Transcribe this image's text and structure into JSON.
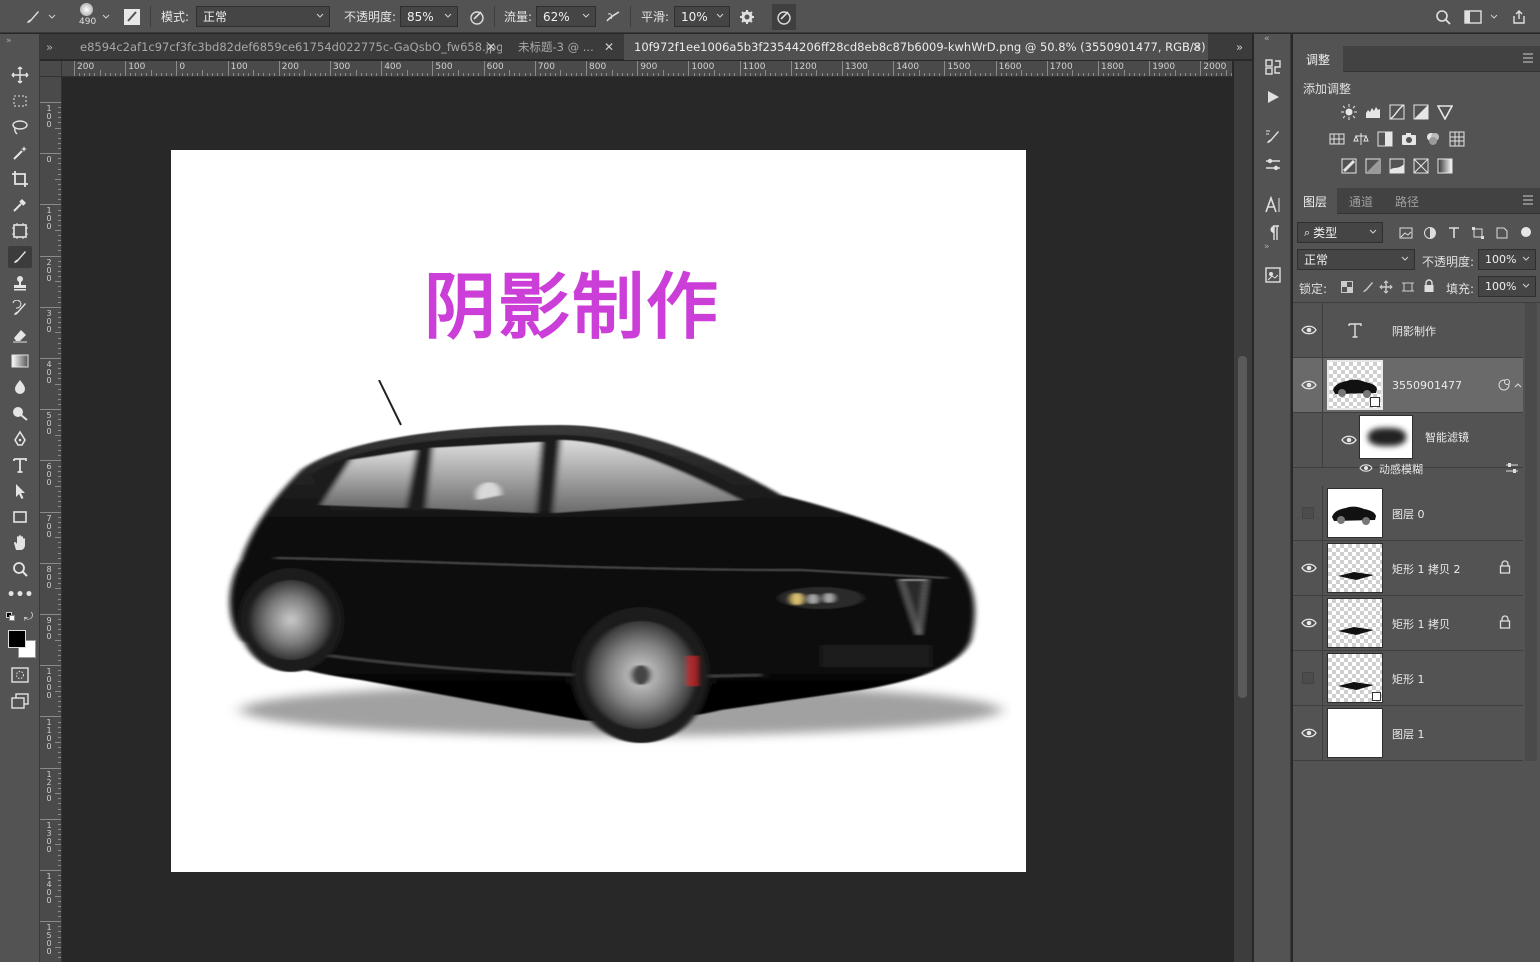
{
  "options_bar": {
    "brush_size": "490",
    "mode_label": "模式:",
    "mode_value": "正常",
    "opacity_label": "不透明度:",
    "opacity_value": "85%",
    "flow_label": "流量:",
    "flow_value": "62%",
    "smoothing_label": "平滑:",
    "smoothing_value": "10%"
  },
  "tabs": [
    {
      "label": "e8594c2af1c97cf3fc3bd82def6859ce61754d022775c-GaQsbO_fw658.jpg",
      "active": false
    },
    {
      "label": "未标题-3 @ ...",
      "active": false
    },
    {
      "label": "10f972f1ee1006a5b3f23544206ff28cd8eb8c87b6009-kwhWrD.png @ 50.8% (3550901477, RGB/8) *",
      "active": true
    }
  ],
  "ruler": {
    "h_ticks": [
      "200",
      "100",
      "0",
      "100",
      "200",
      "300",
      "400",
      "500",
      "600",
      "700",
      "800",
      "900",
      "1000",
      "1100",
      "1200",
      "1300",
      "1400",
      "1500",
      "1600",
      "1700",
      "1800",
      "1900",
      "2000"
    ],
    "v_ticks": [
      "100",
      "0",
      "100",
      "200",
      "300",
      "400",
      "500",
      "600",
      "700",
      "800",
      "900",
      "1000",
      "1100",
      "1200",
      "1300",
      "1400",
      "1500"
    ]
  },
  "canvas": {
    "title_text": "阴影制作"
  },
  "adjustments_panel": {
    "tab": "调整",
    "subtitle": "添加调整"
  },
  "layers_panel": {
    "tabs": [
      "图层",
      "通道",
      "路径"
    ],
    "filter_kind": "类型",
    "blend_mode": "正常",
    "opacity_label": "不透明度:",
    "opacity_value": "100%",
    "lock_label": "锁定:",
    "fill_label": "填充:",
    "fill_value": "100%",
    "layers": [
      {
        "name": "阴影制作",
        "type": "text",
        "visible": true
      },
      {
        "name": "3550901477",
        "type": "smart",
        "visible": true,
        "selected": true
      },
      {
        "name": "智能滤镜",
        "type": "filter-mask",
        "visible": true
      },
      {
        "name": "动感模糊",
        "type": "filter",
        "visible": true
      },
      {
        "name": "图层 0",
        "type": "image",
        "visible": false
      },
      {
        "name": "矩形 1 拷贝 2",
        "type": "shape",
        "visible": true,
        "locked": true
      },
      {
        "name": "矩形 1 拷贝",
        "type": "shape",
        "visible": true,
        "locked": true
      },
      {
        "name": "矩形 1",
        "type": "shape",
        "visible": false
      },
      {
        "name": "图层 1",
        "type": "fill",
        "visible": true
      }
    ]
  },
  "colors": {
    "title_magenta": "#cb3ed8",
    "panel_bg": "#535353",
    "canvas_bg": "#282828"
  }
}
